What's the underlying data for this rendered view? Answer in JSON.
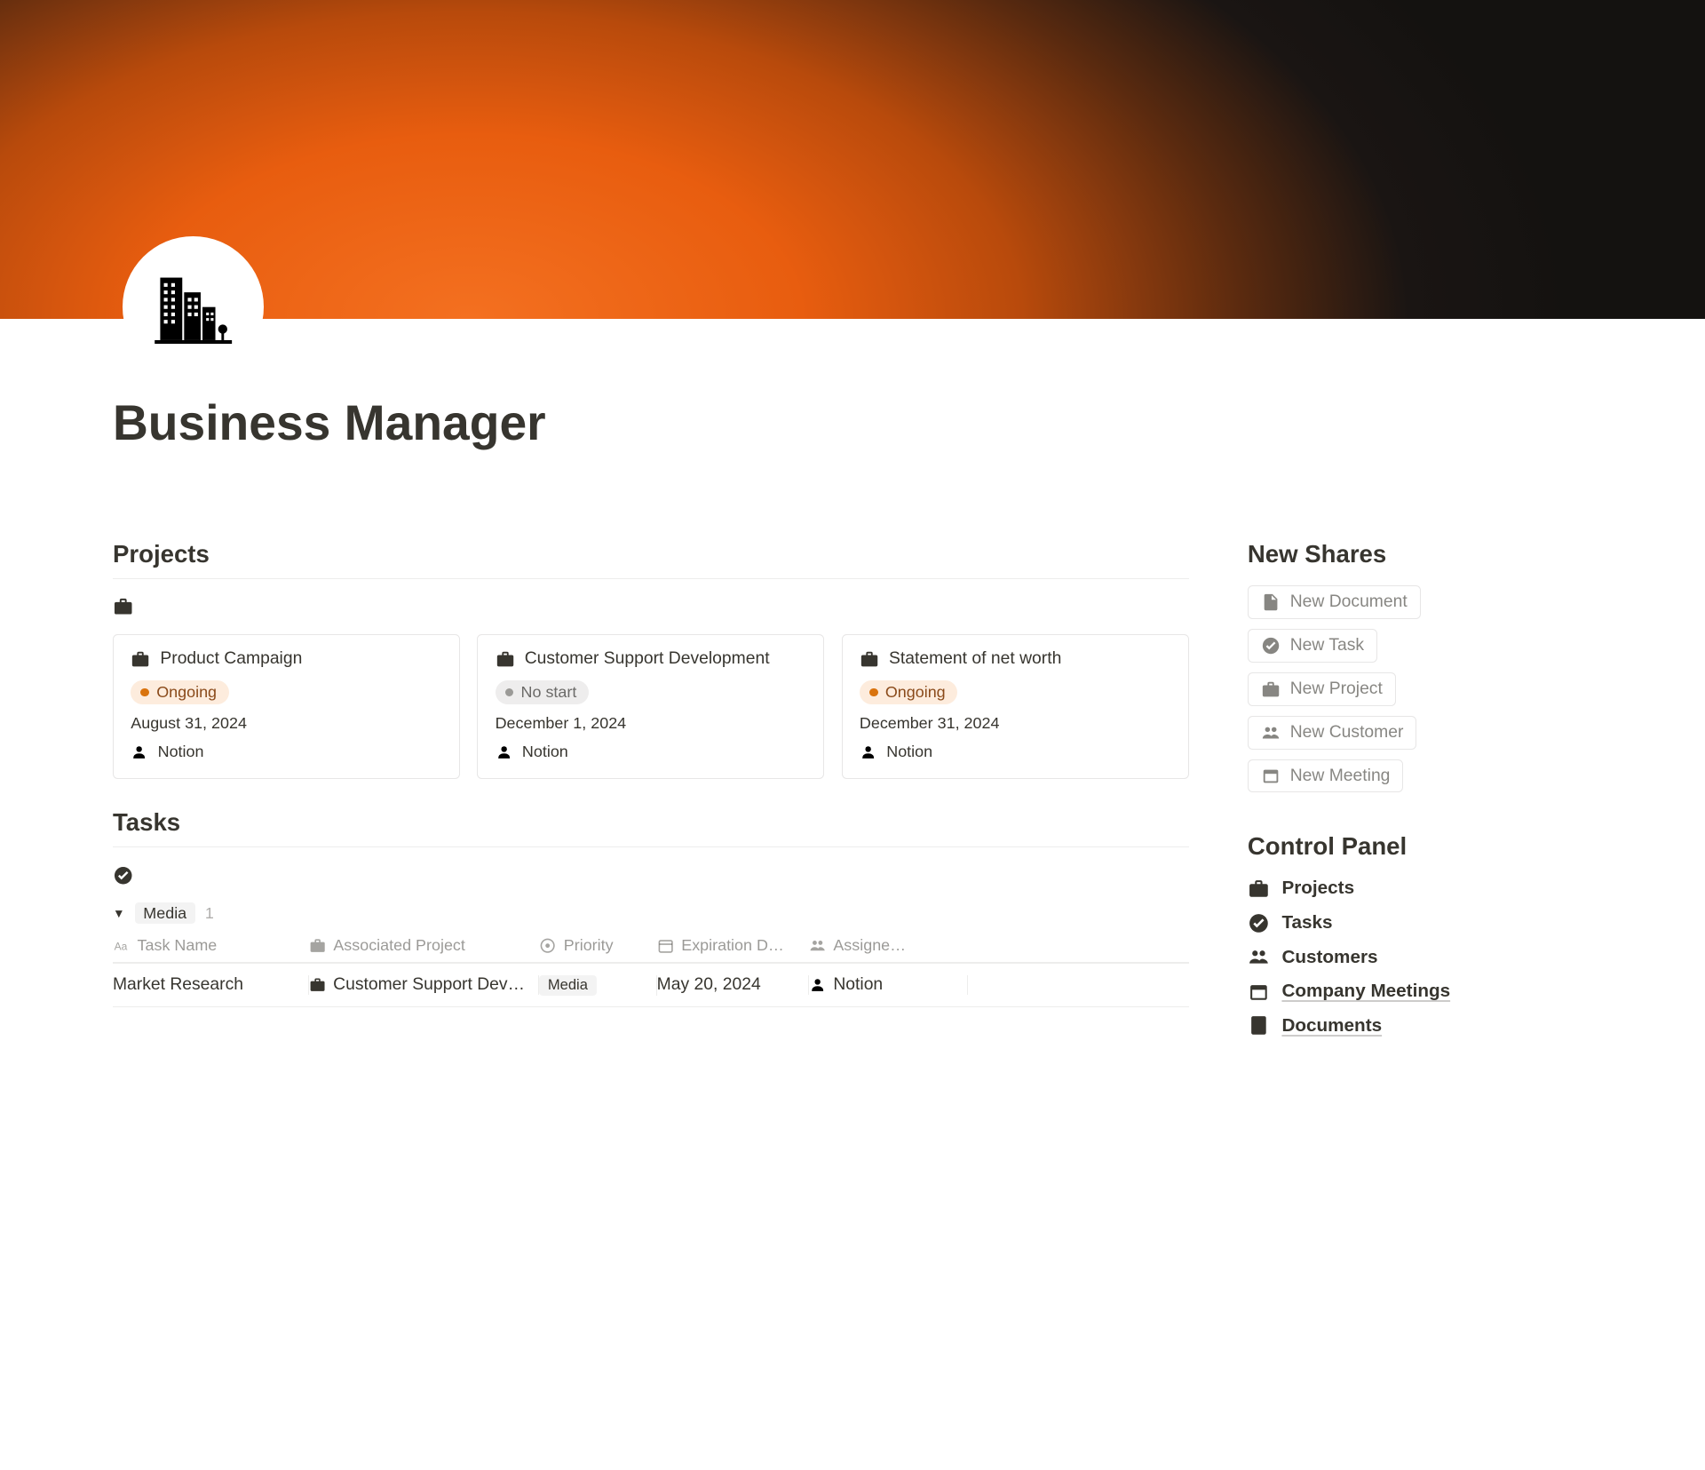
{
  "page": {
    "title": "Business Manager"
  },
  "projects": {
    "heading": "Projects",
    "cards": [
      {
        "title": "Product Campaign",
        "status": "Ongoing",
        "status_color": "orange",
        "date": "August 31, 2024",
        "user": "Notion"
      },
      {
        "title": "Customer Support Development",
        "status": "No start",
        "status_color": "gray",
        "date": "December 1, 2024",
        "user": "Notion"
      },
      {
        "title": "Statement of net worth",
        "status": "Ongoing",
        "status_color": "orange",
        "date": "December 31, 2024",
        "user": "Notion"
      }
    ]
  },
  "tasks": {
    "heading": "Tasks",
    "group_name": "Media",
    "group_count": "1",
    "columns": {
      "name": "Task Name",
      "project": "Associated Project",
      "priority": "Priority",
      "expiration": "Expiration D…",
      "assignee": "Assigne…"
    },
    "rows": [
      {
        "name": "Market Research",
        "project": "Customer Support Develo",
        "priority_tag": "Media",
        "expiration": "May 20, 2024",
        "assignee": "Notion"
      }
    ]
  },
  "sidebar": {
    "new_shares_heading": "New Shares",
    "buttons": {
      "new_document": "New Document",
      "new_task": "New Task",
      "new_project": "New Project",
      "new_customer": "New Customer",
      "new_meeting": "New Meeting"
    },
    "control_panel_heading": "Control Panel",
    "control_items": {
      "projects": "Projects",
      "tasks": "Tasks",
      "customers": "Customers",
      "company_meetings": "Company Meetings",
      "documents": "Documents"
    }
  }
}
